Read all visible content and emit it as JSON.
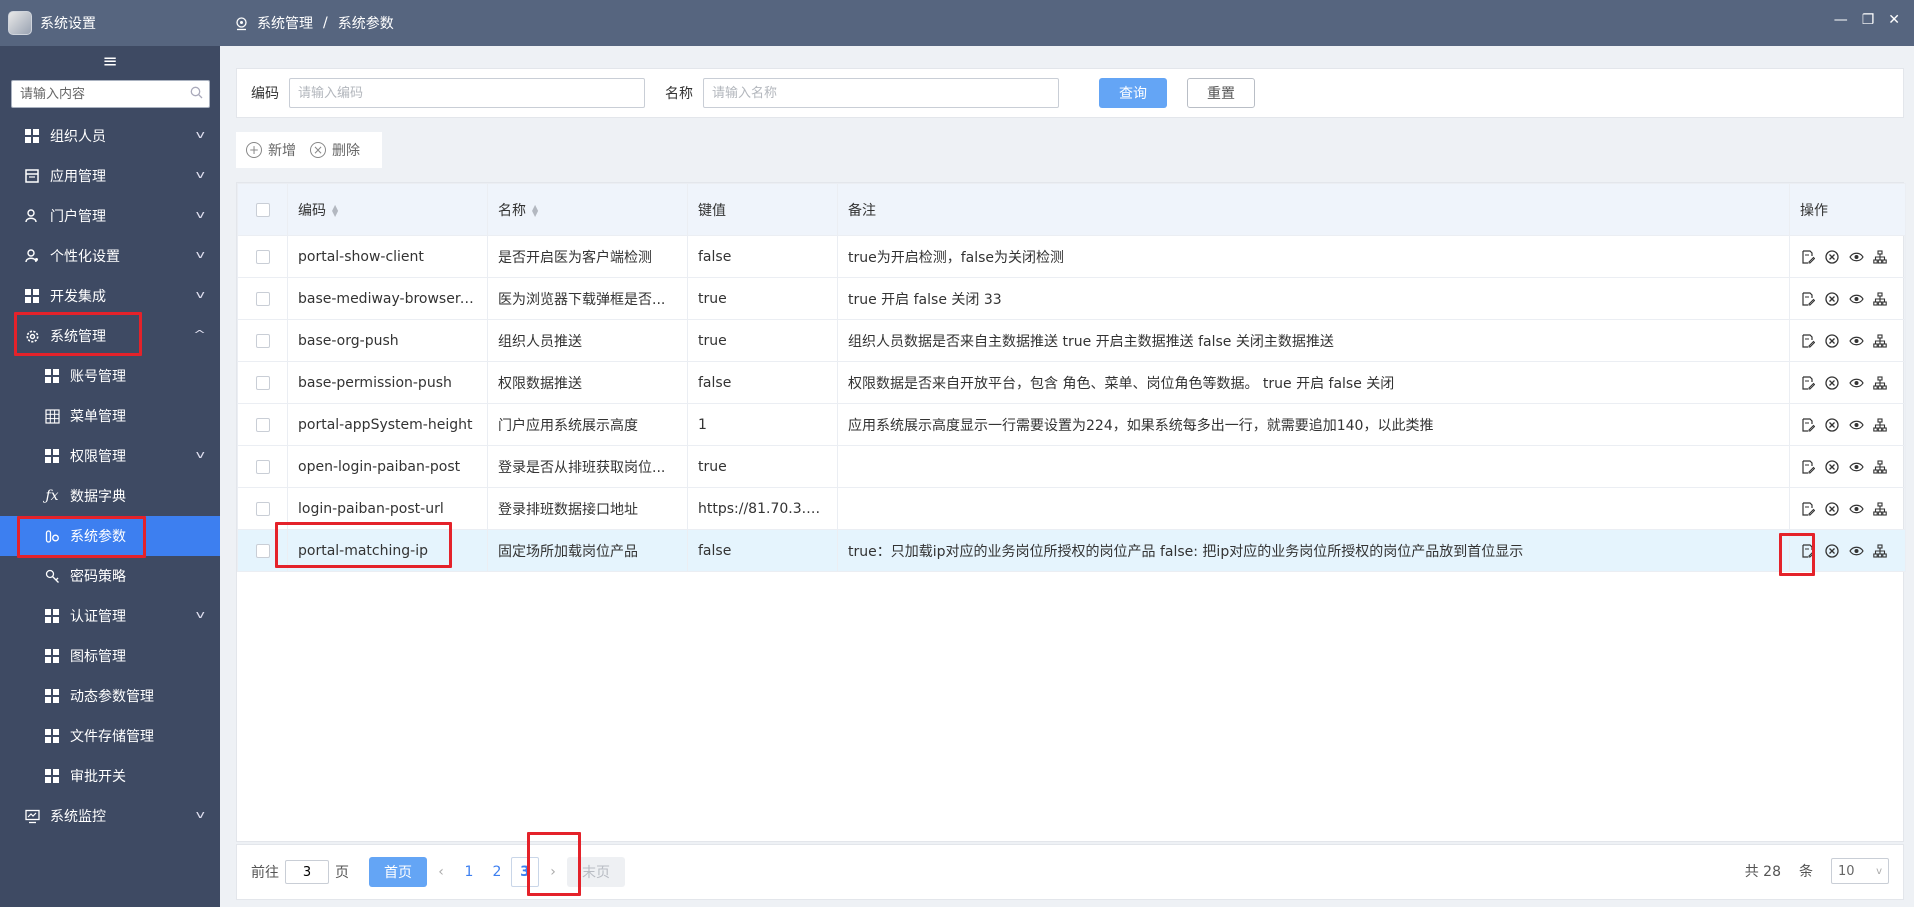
{
  "app": {
    "title": "系统设置"
  },
  "sidebar": {
    "search_placeholder": "请输入内容",
    "items": [
      {
        "label": "组织人员"
      },
      {
        "label": "应用管理"
      },
      {
        "label": "门户管理"
      },
      {
        "label": "个性化设置"
      },
      {
        "label": "开发集成"
      },
      {
        "label": "系统管理"
      },
      {
        "label": "账号管理"
      },
      {
        "label": "菜单管理"
      },
      {
        "label": "权限管理"
      },
      {
        "label": "数据字典"
      },
      {
        "label": "系统参数"
      },
      {
        "label": "密码策略"
      },
      {
        "label": "认证管理"
      },
      {
        "label": "图标管理"
      },
      {
        "label": "动态参数管理"
      },
      {
        "label": "文件存储管理"
      },
      {
        "label": "审批开关"
      },
      {
        "label": "系统监控"
      }
    ]
  },
  "breadcrumb": {
    "parent": "系统管理",
    "separator": "/",
    "current": "系统参数"
  },
  "window_controls": {
    "minimize": "—",
    "restore": "❐",
    "close": "✕"
  },
  "filter": {
    "code_label": "编码",
    "code_placeholder": "请输入编码",
    "name_label": "名称",
    "name_placeholder": "请输入名称",
    "query_label": "查询",
    "reset_label": "重置"
  },
  "toolbar": {
    "add_label": "新增",
    "delete_label": "删除"
  },
  "table": {
    "headers": {
      "code": "编码",
      "name": "名称",
      "value": "键值",
      "remark": "备注",
      "actions": "操作"
    },
    "rows": [
      {
        "code": "portal-show-client",
        "name": "是否开启医为客户端检测",
        "value": "false",
        "remark": "true为开启检测，false为关闭检测"
      },
      {
        "code": "base-mediway-browser-...",
        "name": "医为浏览器下载弹框是否...",
        "value": "true",
        "remark": "true 开启 false 关闭 33"
      },
      {
        "code": "base-org-push",
        "name": "组织人员推送",
        "value": "true",
        "remark": "组织人员数据是否来自主数据推送 true 开启主数据推送 false 关闭主数据推送"
      },
      {
        "code": "base-permission-push",
        "name": "权限数据推送",
        "value": "false",
        "remark": "权限数据是否来自开放平台，包含 角色、菜单、岗位角色等数据。 true 开启 false 关闭"
      },
      {
        "code": "portal-appSystem-height",
        "name": "门户应用系统展示高度",
        "value": "1",
        "remark": "应用系统展示高度显示一行需要设置为224，如果系统每多出一行，就需要追加140，以此类推"
      },
      {
        "code": "open-login-paiban-post",
        "name": "登录是否从排班获取岗位...",
        "value": "true",
        "remark": ""
      },
      {
        "code": "login-paiban-post-url",
        "name": "登录排班数据接口地址",
        "value": "https://81.70.3.21...",
        "remark": ""
      },
      {
        "code": "portal-matching-ip",
        "name": "固定场所加载岗位产品",
        "value": "false",
        "remark": "true：只加载ip对应的业务岗位所授权的岗位产品 false: 把ip对应的业务岗位所授权的岗位产品放到首位显示"
      }
    ]
  },
  "pager": {
    "goto_prefix": "前往",
    "goto_value": "3",
    "goto_suffix": "页",
    "first_label": "首页",
    "last_label": "末页",
    "prev_icon": "‹",
    "next_icon": "›",
    "pages": [
      "1",
      "2",
      "3"
    ],
    "current_page": "3",
    "total_text": "共 28",
    "unit": "条",
    "page_size": "10"
  }
}
